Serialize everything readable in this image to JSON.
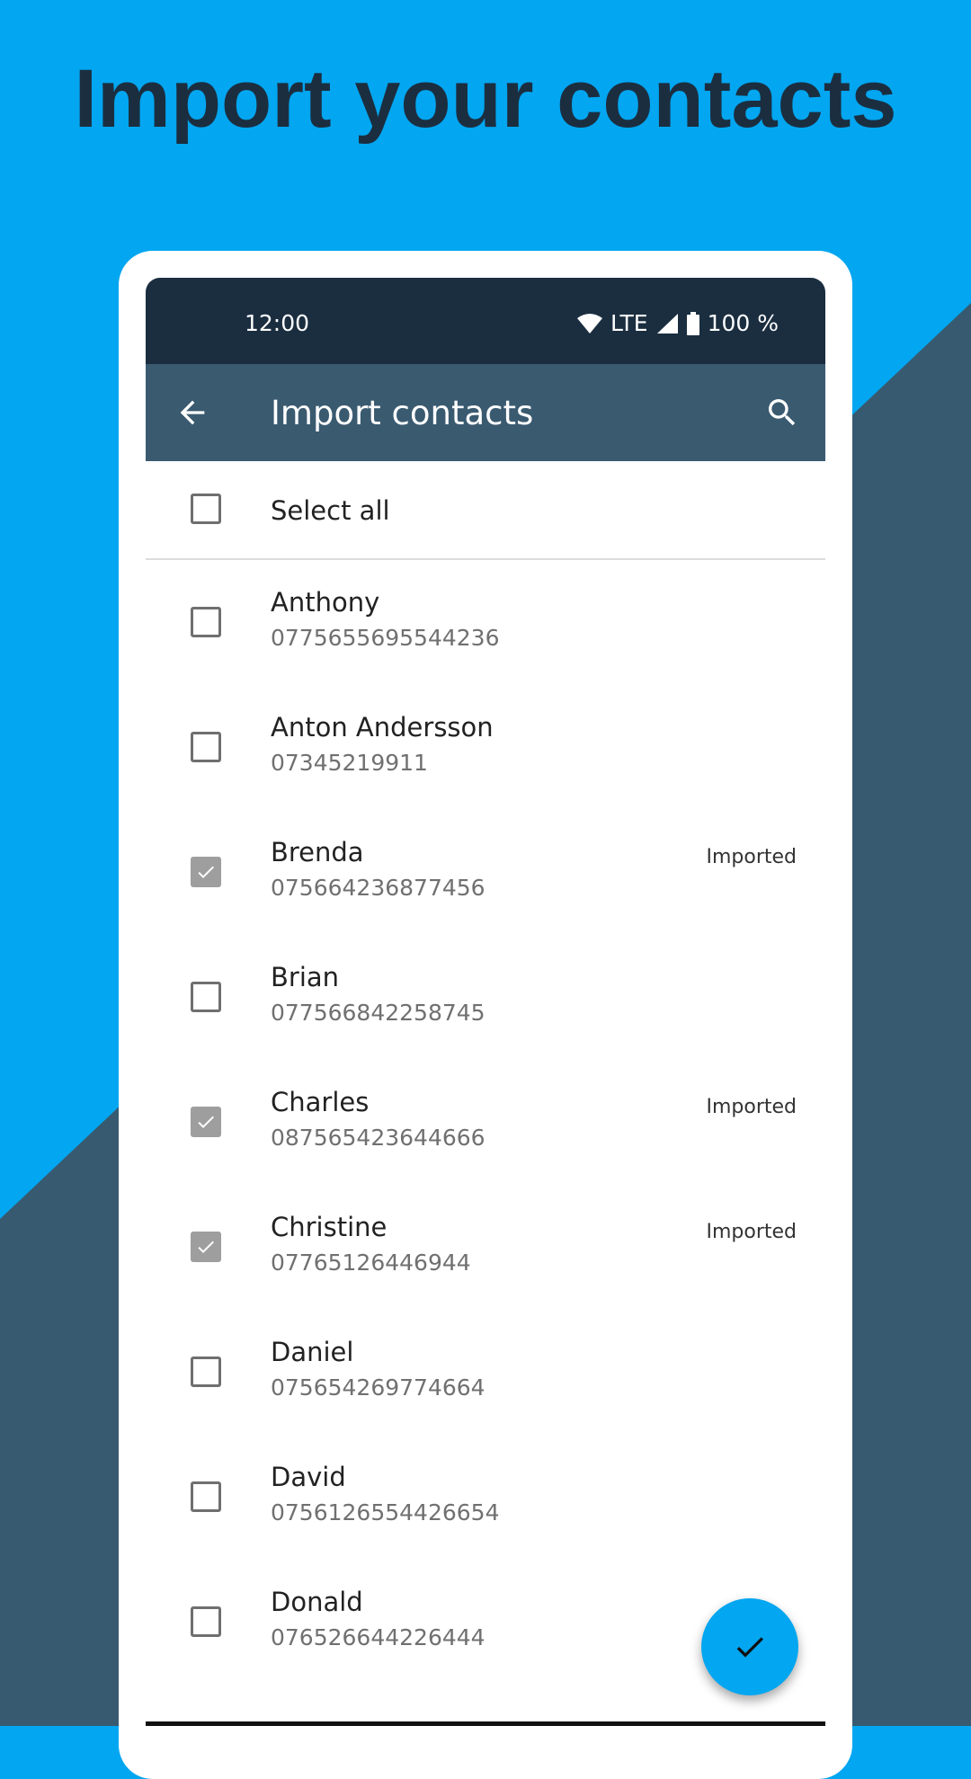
{
  "headline": "Import your contacts",
  "colors": {
    "background": "#03a6f0",
    "diagonal": "#375a70",
    "headline": "#1b2e40",
    "statusbar": "#1b2e40",
    "appbar": "#3a5a70",
    "fab": "#03a6f0"
  },
  "status": {
    "time": "12:00",
    "network": "LTE",
    "battery": "100 %",
    "icons": [
      "wifi-icon",
      "signal-icon",
      "battery-icon"
    ]
  },
  "appbar": {
    "title": "Import contacts",
    "back_icon": "arrow-left-icon",
    "search_icon": "search-icon"
  },
  "select_all": {
    "label": "Select all",
    "checked": false
  },
  "contacts": [
    {
      "name": "Anthony",
      "phone": "0775655695544236",
      "checked": false,
      "badge": ""
    },
    {
      "name": "Anton Andersson",
      "phone": "07345219911",
      "checked": false,
      "badge": ""
    },
    {
      "name": "Brenda",
      "phone": "075664236877456",
      "checked": true,
      "badge": "Imported"
    },
    {
      "name": "Brian",
      "phone": "077566842258745",
      "checked": false,
      "badge": ""
    },
    {
      "name": "Charles",
      "phone": "087565423644666",
      "checked": true,
      "badge": "Imported"
    },
    {
      "name": "Christine",
      "phone": "07765126446944",
      "checked": true,
      "badge": "Imported"
    },
    {
      "name": "Daniel",
      "phone": "075654269774664",
      "checked": false,
      "badge": ""
    },
    {
      "name": "David",
      "phone": "0756126554426654",
      "checked": false,
      "badge": ""
    },
    {
      "name": "Donald",
      "phone": "076526644226444",
      "checked": false,
      "badge": ""
    }
  ],
  "fab": {
    "icon": "check-icon"
  }
}
